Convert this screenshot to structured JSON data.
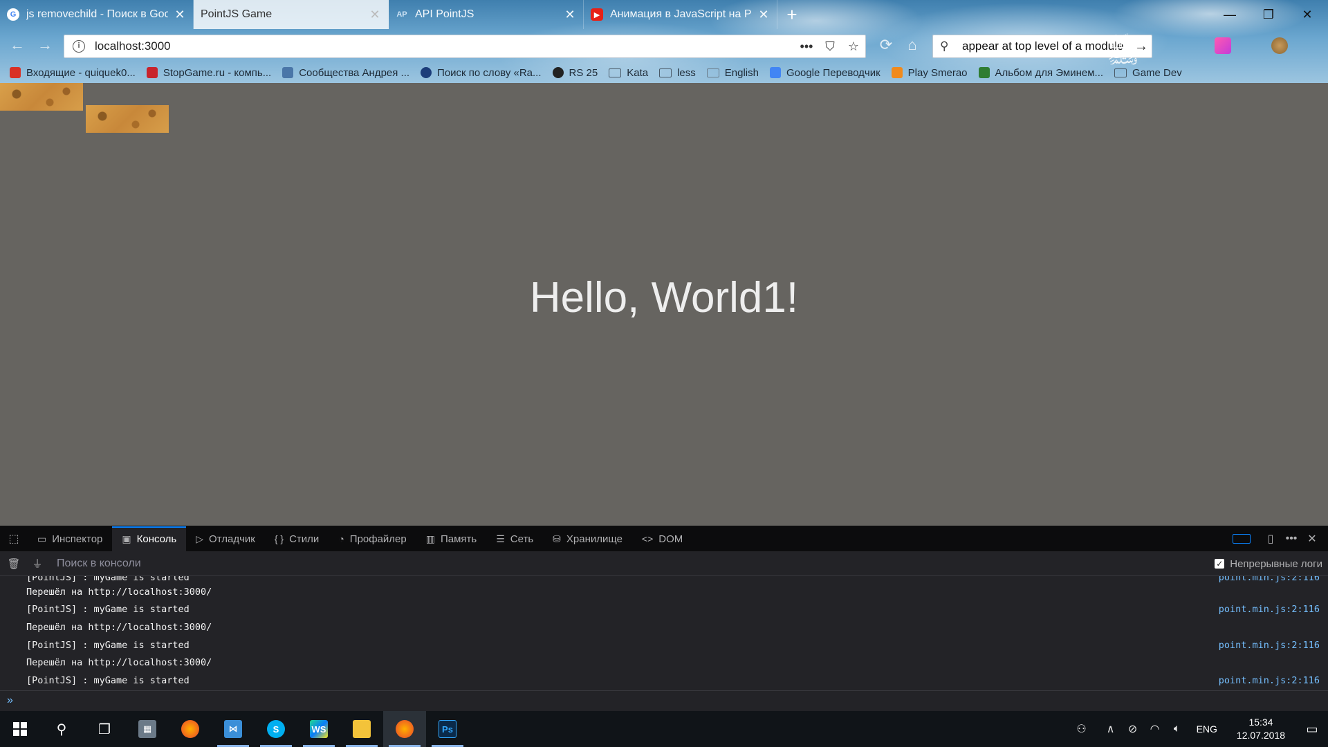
{
  "browser": {
    "tabs": [
      {
        "title": "js removechild - Поиск в Goo",
        "favicon": "google-icon",
        "active": false
      },
      {
        "title": "PointJS Game",
        "favicon": "",
        "active": true
      },
      {
        "title": "API PointJS",
        "favicon": "pointjs-icon",
        "active": false
      },
      {
        "title": "Анимация в JavaScript на Po",
        "favicon": "youtube-icon",
        "active": false
      }
    ],
    "url": "localhost:3000",
    "search_value": "appear at top level of a module",
    "bookmarks": [
      "Входящие - quiquek0...",
      "StopGame.ru - компь...",
      "Сообщества Андрея ...",
      "Поиск по слову «Ra...",
      "RS 25",
      "Kata",
      "less",
      "English",
      "Google Переводчик",
      "Play Smerao",
      "Альбом для Эминем...",
      "Game Dev"
    ]
  },
  "page": {
    "heading": "Hello, World1!"
  },
  "devtools": {
    "tabs": [
      {
        "label": "Инспектор",
        "icon": "inspector-icon"
      },
      {
        "label": "Консоль",
        "icon": "console-icon",
        "active": true
      },
      {
        "label": "Отладчик",
        "icon": "debugger-icon"
      },
      {
        "label": "Стили",
        "icon": "styles-icon"
      },
      {
        "label": "Профайлер",
        "icon": "profiler-icon"
      },
      {
        "label": "Память",
        "icon": "memory-icon"
      },
      {
        "label": "Сеть",
        "icon": "network-icon"
      },
      {
        "label": "Хранилище",
        "icon": "storage-icon"
      },
      {
        "label": "DOM",
        "icon": "dom-icon"
      }
    ],
    "filter_placeholder": "Поиск в консоли",
    "persist_logs_label": "Непрерывные логи",
    "persist_logs_checked": true,
    "log": [
      {
        "text": "[PointJS] :  myGame is started",
        "source": "point.min.js:2:116"
      },
      {
        "text": "Перешёл на http://localhost:3000/",
        "source": ""
      },
      {
        "text": "[PointJS] :  myGame is started",
        "source": "point.min.js:2:116"
      },
      {
        "text": "Перешёл на http://localhost:3000/",
        "source": ""
      },
      {
        "text": "[PointJS] :  myGame is started",
        "source": "point.min.js:2:116"
      },
      {
        "text": "Перешёл на http://localhost:3000/",
        "source": ""
      },
      {
        "text": "[PointJS] :  myGame is started",
        "source": "point.min.js:2:116"
      }
    ],
    "accent_color": "#0a84ff"
  },
  "taskbar": {
    "apps": [
      "start-icon",
      "search-icon",
      "task-view-icon",
      "calculator-icon",
      "firefox-icon",
      "visual-studio-icon",
      "skype-icon",
      "webstorm-icon",
      "file-explorer-icon",
      "firefox-icon",
      "photoshop-icon"
    ],
    "language": "ENG",
    "time": "15:34",
    "date": "12.07.2018"
  }
}
